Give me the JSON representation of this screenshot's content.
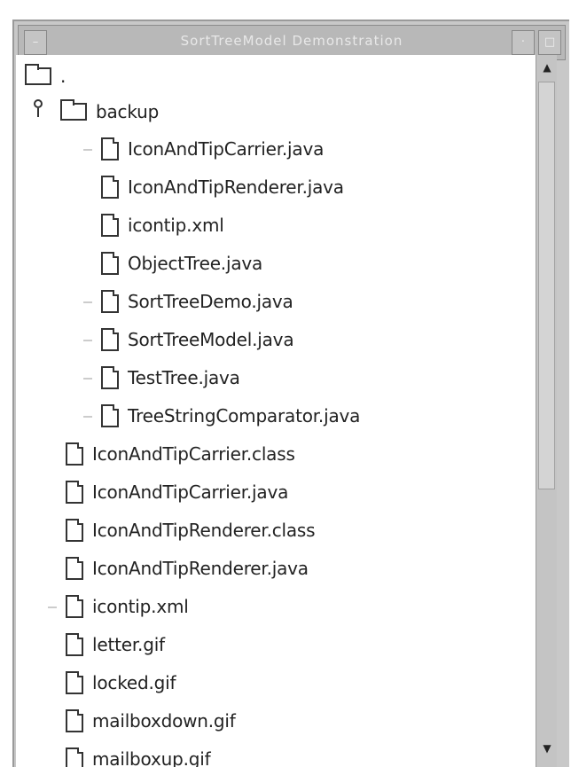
{
  "window": {
    "title": "SortTreeModel Demonstration"
  },
  "tree": {
    "root": {
      "label": "."
    },
    "backup_folder": {
      "label": "backup",
      "children": [
        "IconAndTipCarrier.java",
        "IconAndTipRenderer.java",
        "icontip.xml",
        "ObjectTree.java",
        "SortTreeDemo.java",
        "SortTreeModel.java",
        "TestTree.java",
        "TreeStringComparator.java"
      ]
    },
    "files": [
      "IconAndTipCarrier.class",
      "IconAndTipCarrier.java",
      "IconAndTipRenderer.class",
      "IconAndTipRenderer.java",
      "icontip.xml",
      "letter.gif",
      "locked.gif",
      "mailboxdown.gif",
      "mailboxup.gif"
    ]
  },
  "icons": {
    "folder": "folder-icon",
    "file": "file-icon",
    "expand_toggle": "expanded-toggle-icon"
  }
}
